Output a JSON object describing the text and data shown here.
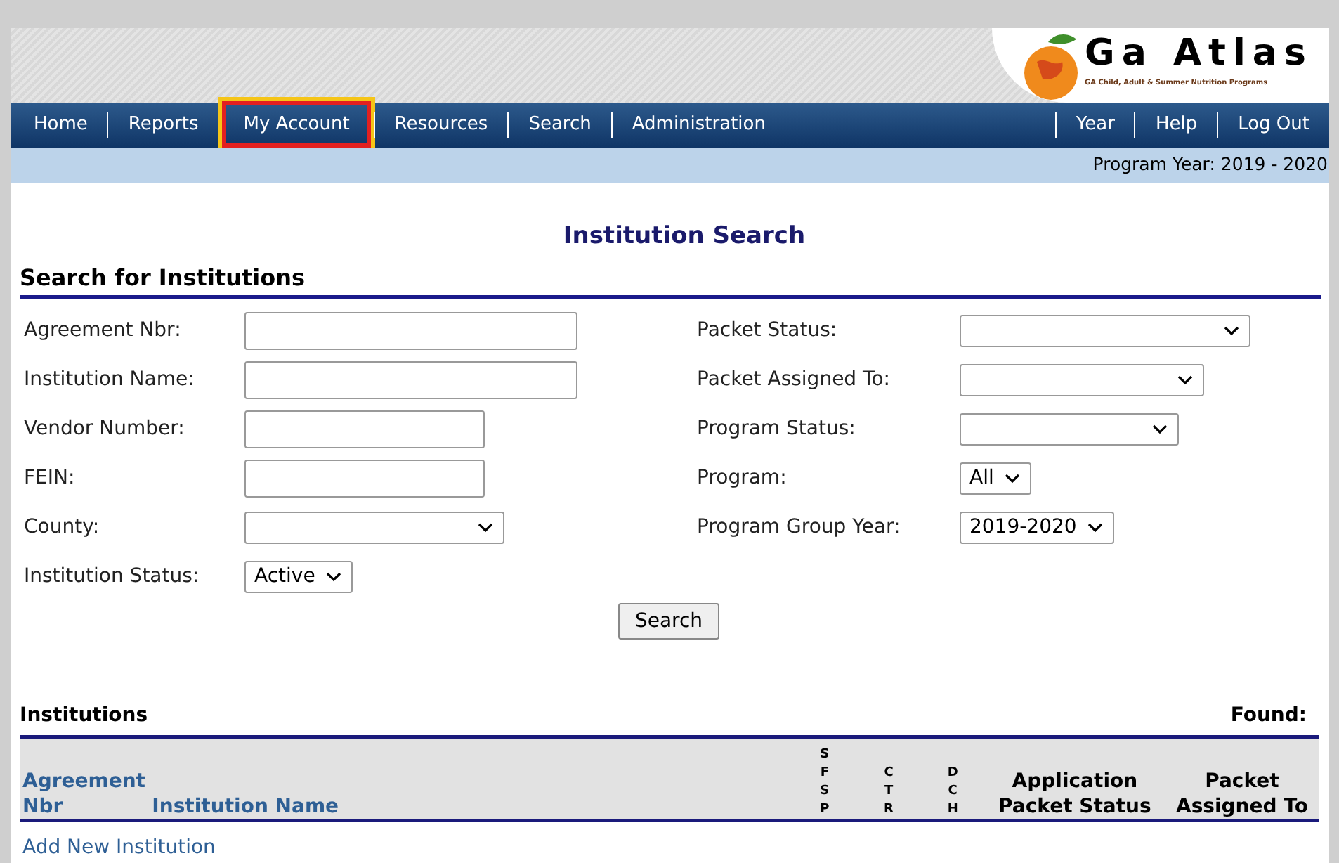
{
  "header": {
    "logo_title": "Ga Atlas",
    "logo_subtitle": "GA Child, Adult & Summer Nutrition Programs"
  },
  "nav": {
    "left": [
      {
        "label": "Home",
        "selected": false
      },
      {
        "label": "Reports",
        "selected": false
      },
      {
        "label": "My Account",
        "selected": true
      },
      {
        "label": "Resources",
        "selected": false
      },
      {
        "label": "Search",
        "selected": false
      },
      {
        "label": "Administration",
        "selected": false
      }
    ],
    "right": [
      {
        "label": "Year",
        "selected": false
      },
      {
        "label": "Help",
        "selected": false
      },
      {
        "label": "Log Out",
        "selected": false
      }
    ]
  },
  "program_year": "Program Year: 2019 - 2020",
  "page_title": "Institution Search",
  "search_section": {
    "title": "Search for Institutions",
    "left_fields": [
      {
        "label": "Agreement Nbr:",
        "kind": "text"
      },
      {
        "label": "Institution Name:",
        "kind": "text"
      },
      {
        "label": "Vendor Number:",
        "kind": "text"
      },
      {
        "label": "FEIN:",
        "kind": "text"
      },
      {
        "label": "County:",
        "kind": "select"
      },
      {
        "label": "Institution Status:",
        "kind": "select",
        "value": "Active"
      }
    ],
    "right_fields": [
      {
        "label": "Packet Status:",
        "kind": "select"
      },
      {
        "label": "Packet Assigned To:",
        "kind": "select"
      },
      {
        "label": "Program Status:",
        "kind": "select"
      },
      {
        "label": "Program:",
        "kind": "select",
        "value": "All"
      },
      {
        "label": "Program Group Year:",
        "kind": "select",
        "value": "2019-2020"
      }
    ],
    "search_button": "Search"
  },
  "results": {
    "title": "Institutions",
    "found_label": "Found:",
    "columns": [
      {
        "label": "Agreement Nbr",
        "kind": "link"
      },
      {
        "label": "Institution Name",
        "kind": "link"
      },
      {
        "label": "SFSP",
        "kind": "vertical"
      },
      {
        "label": "CTR",
        "kind": "vertical"
      },
      {
        "label": "DCH",
        "kind": "vertical"
      },
      {
        "label": "Application Packet Status",
        "kind": "plain"
      },
      {
        "label": "Packet Assigned To",
        "kind": "plain"
      }
    ],
    "add_link": "Add New Institution"
  }
}
